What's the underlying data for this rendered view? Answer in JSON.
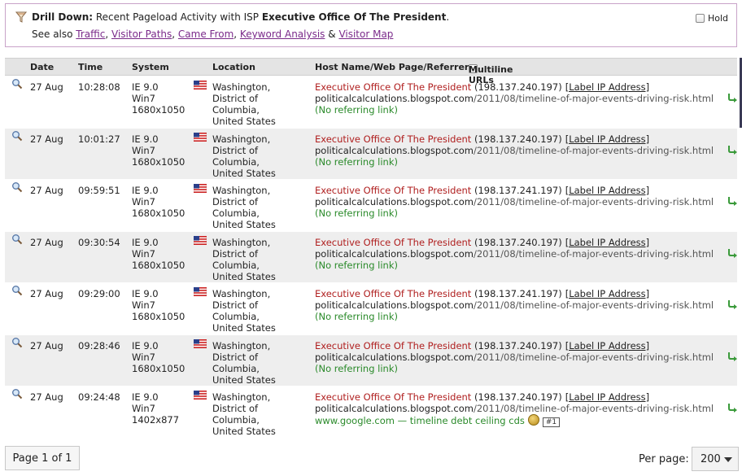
{
  "drilldown": {
    "prefix": "Drill Down:",
    "text": " Recent Pageload Activity with ISP ",
    "isp": "Executive Office Of The President",
    "suffix": ".",
    "see_also": "See also ",
    "links": [
      "Traffic",
      "Visitor Paths",
      "Came From",
      "Keyword Analysis",
      "Visitor Map"
    ],
    "sep1": ", ",
    "sep2": ", ",
    "sep3": ", ",
    "sep4": " & ",
    "hold_label": "Hold"
  },
  "table": {
    "headers": {
      "date": "Date",
      "time": "Time",
      "system": "System",
      "location": "Location",
      "host": "Host Name/Web Page/Referrer",
      "multiline": "Multiline URLs"
    },
    "rows": [
      {
        "date": "27 Aug",
        "time": "10:28:08",
        "browser": "IE 9.0",
        "os": "Win7",
        "res": "1680x1050",
        "city": "Washington,",
        "region1": "District of",
        "region2": "Columbia,",
        "country": "United States",
        "isp": "Executive Office Of The President",
        "ip": "(198.137.240.197)",
        "label": "[Label IP Address]",
        "domain": "politicalcalculations.blogspot.com",
        "path": "/2011/08/timeline-of-major-events-driving-risk.html",
        "ref": "(No referring link)"
      },
      {
        "date": "27 Aug",
        "time": "10:01:27",
        "browser": "IE 9.0",
        "os": "Win7",
        "res": "1680x1050",
        "city": "Washington,",
        "region1": "District of",
        "region2": "Columbia,",
        "country": "United States",
        "isp": "Executive Office Of The President",
        "ip": "(198.137.240.197)",
        "label": "[Label IP Address]",
        "domain": "politicalcalculations.blogspot.com",
        "path": "/2011/08/timeline-of-major-events-driving-risk.html",
        "ref": "(No referring link)"
      },
      {
        "date": "27 Aug",
        "time": "09:59:51",
        "browser": "IE 9.0",
        "os": "Win7",
        "res": "1680x1050",
        "city": "Washington,",
        "region1": "District of",
        "region2": "Columbia,",
        "country": "United States",
        "isp": "Executive Office Of The President",
        "ip": "(198.137.241.197)",
        "label": "[Label IP Address]",
        "domain": "politicalcalculations.blogspot.com",
        "path": "/2011/08/timeline-of-major-events-driving-risk.html",
        "ref": "(No referring link)"
      },
      {
        "date": "27 Aug",
        "time": "09:30:54",
        "browser": "IE 9.0",
        "os": "Win7",
        "res": "1680x1050",
        "city": "Washington,",
        "region1": "District of",
        "region2": "Columbia,",
        "country": "United States",
        "isp": "Executive Office Of The President",
        "ip": "(198.137.240.197)",
        "label": "[Label IP Address]",
        "domain": "politicalcalculations.blogspot.com",
        "path": "/2011/08/timeline-of-major-events-driving-risk.html",
        "ref": "(No referring link)"
      },
      {
        "date": "27 Aug",
        "time": "09:29:00",
        "browser": "IE 9.0",
        "os": "Win7",
        "res": "1680x1050",
        "city": "Washington,",
        "region1": "District of",
        "region2": "Columbia,",
        "country": "United States",
        "isp": "Executive Office Of The President",
        "ip": "(198.137.241.197)",
        "label": "[Label IP Address]",
        "domain": "politicalcalculations.blogspot.com",
        "path": "/2011/08/timeline-of-major-events-driving-risk.html",
        "ref": "(No referring link)"
      },
      {
        "date": "27 Aug",
        "time": "09:28:46",
        "browser": "IE 9.0",
        "os": "Win7",
        "res": "1680x1050",
        "city": "Washington,",
        "region1": "District of",
        "region2": "Columbia,",
        "country": "United States",
        "isp": "Executive Office Of The President",
        "ip": "(198.137.240.197)",
        "label": "[Label IP Address]",
        "domain": "politicalcalculations.blogspot.com",
        "path": "/2011/08/timeline-of-major-events-driving-risk.html",
        "ref": "(No referring link)"
      },
      {
        "date": "27 Aug",
        "time": "09:24:48",
        "browser": "IE 9.0",
        "os": "Win7",
        "res": "1402x877",
        "city": "Washington,",
        "region1": "District of",
        "region2": "Columbia,",
        "country": "United States",
        "isp": "Executive Office Of The President",
        "ip": "(198.137.240.197)",
        "label": "[Label IP Address]",
        "domain": "politicalcalculations.blogspot.com",
        "path": "/2011/08/timeline-of-major-events-driving-risk.html",
        "ref": "www.google.com — timeline debt ceiling cds",
        "rank": "#1"
      }
    ]
  },
  "footer": {
    "page_label": "Page 1 of 1",
    "per_page_label": "Per page:",
    "per_page_value": "200"
  },
  "colors": {
    "isp": "#b02020",
    "referrer": "#2a8a2a",
    "link": "#7a2a8a",
    "alt_row": "#eeeeee"
  }
}
